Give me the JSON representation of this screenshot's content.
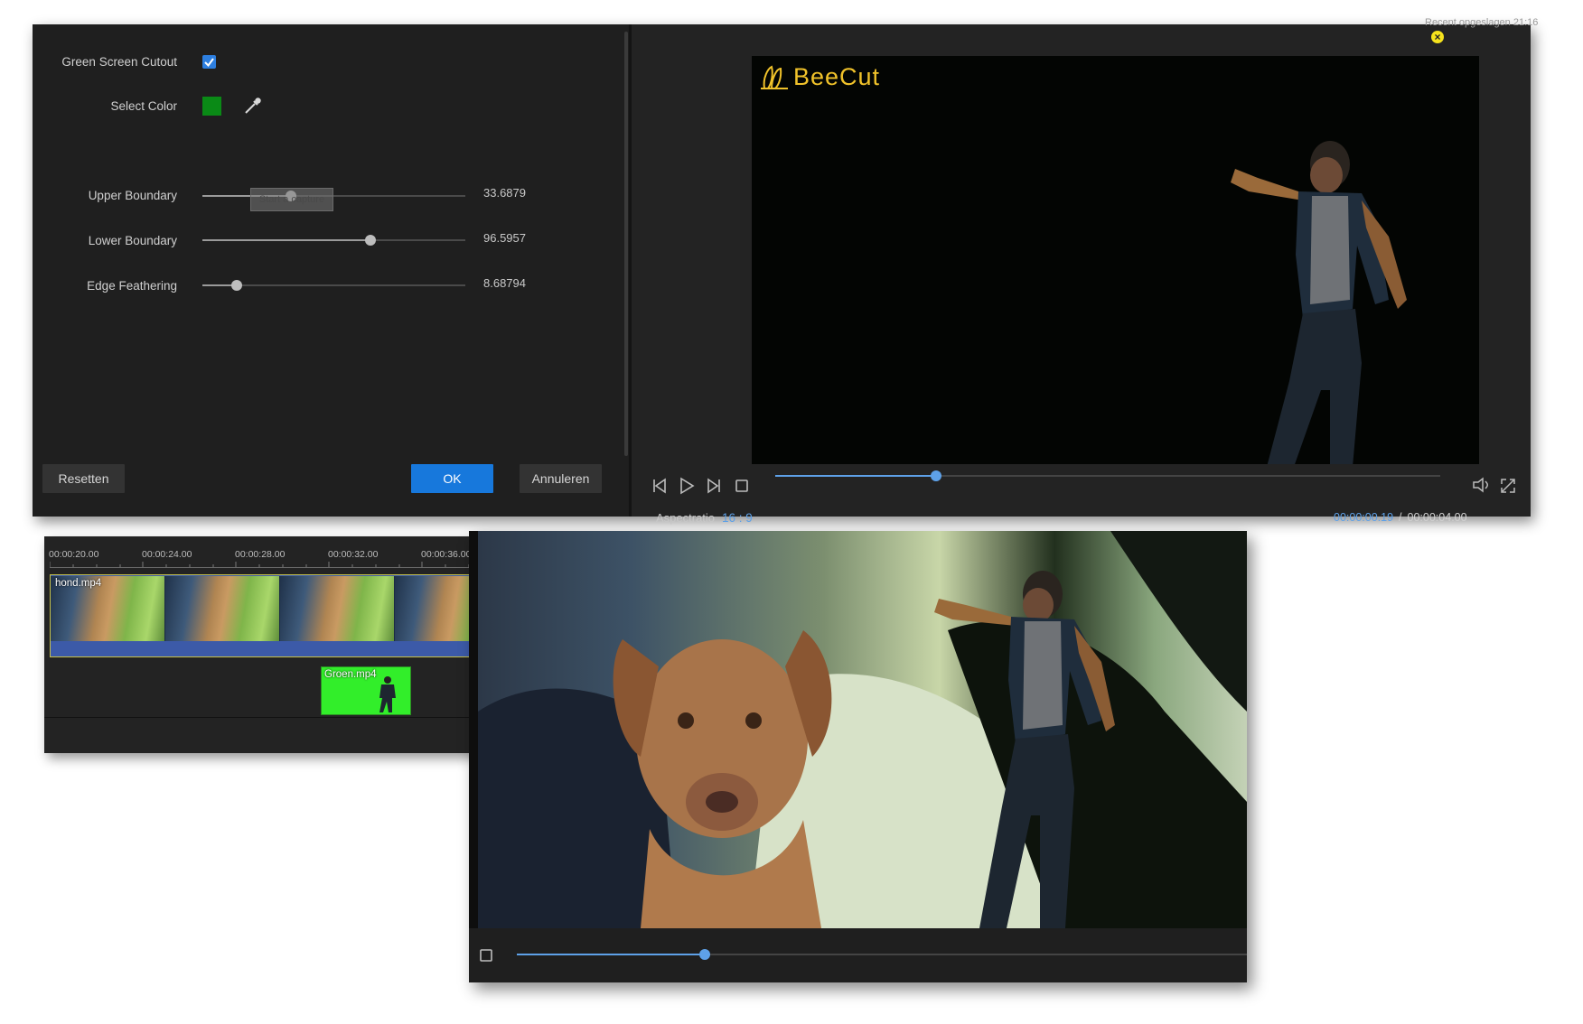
{
  "editor": {
    "green_screen": {
      "label": "Green Screen Cutout",
      "checked": true
    },
    "select_color": {
      "label": "Select Color",
      "color": "#0a8a16"
    },
    "sliders": [
      {
        "label": "Upper Boundary",
        "value": "33.6879",
        "fraction": 0.34
      },
      {
        "label": "Lower Boundary",
        "value": "96.5957",
        "fraction": 0.64
      },
      {
        "label": "Edge Feathering",
        "value": "8.68794",
        "fraction": 0.13
      }
    ],
    "tooltip": "Start a capture",
    "buttons": {
      "reset": "Resetten",
      "ok": "OK",
      "cancel": "Annuleren"
    }
  },
  "player": {
    "header_text": "Recent opgeslagen 21:16",
    "logo": "BeeCut",
    "aspect_label": "Aspectratio",
    "aspect_value": "16 : 9",
    "current_time": "00:00:00.19",
    "time_separator": "/",
    "total_time": "00:00:04.00",
    "progress": 0.24,
    "icons": [
      "prev-frame-icon",
      "play-icon",
      "next-frame-icon",
      "stop-icon",
      "volume-icon",
      "fullscreen-icon"
    ]
  },
  "timeline": {
    "ticks": [
      "00:00:20.00",
      "00:00:24.00",
      "00:00:28.00",
      "00:00:32.00",
      "00:00:36.00"
    ],
    "clips": {
      "main": "hond.mp4",
      "overlay": "Groen.mp4"
    }
  },
  "preview2": {
    "progress": 0.31,
    "icons": [
      "stop-icon"
    ]
  },
  "colors": {
    "accent": "#1778dc",
    "progress": "#5ea1e8",
    "logo": "#f0c22a",
    "green": "#32ee2a"
  }
}
